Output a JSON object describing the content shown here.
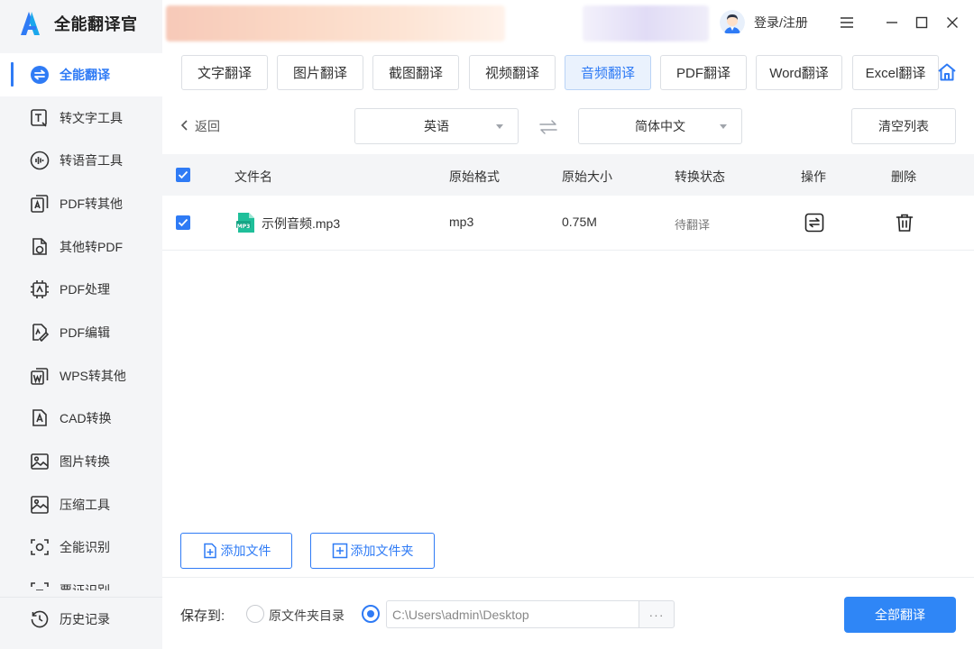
{
  "app": {
    "title": "全能翻译官"
  },
  "header": {
    "login_label": "登录/注册"
  },
  "sidebar": {
    "items": [
      {
        "label": "全能翻译",
        "icon": "translate-icon",
        "active": true
      },
      {
        "label": "转文字工具",
        "icon": "text-convert-icon"
      },
      {
        "label": "转语音工具",
        "icon": "voice-icon"
      },
      {
        "label": "PDF转其他",
        "icon": "pdf-export-icon"
      },
      {
        "label": "其他转PDF",
        "icon": "pdf-import-icon"
      },
      {
        "label": "PDF处理",
        "icon": "pdf-process-icon"
      },
      {
        "label": "PDF编辑",
        "icon": "pdf-edit-icon"
      },
      {
        "label": "WPS转其他",
        "icon": "wps-icon"
      },
      {
        "label": "CAD转换",
        "icon": "cad-icon"
      },
      {
        "label": "图片转换",
        "icon": "image-convert-icon"
      },
      {
        "label": "压缩工具",
        "icon": "compress-icon"
      },
      {
        "label": "全能识别",
        "icon": "recognize-icon"
      },
      {
        "label": "票证识别",
        "icon": "ticket-icon"
      }
    ],
    "history_label": "历史记录"
  },
  "tabs": [
    "文字翻译",
    "图片翻译",
    "截图翻译",
    "视频翻译",
    "音频翻译",
    "PDF翻译",
    "Word翻译",
    "Excel翻译"
  ],
  "active_tab": "音频翻译",
  "toolbar": {
    "back_label": "返回",
    "source_lang": "英语",
    "target_lang": "简体中文",
    "clear_label": "清空列表"
  },
  "table": {
    "columns": [
      "文件名",
      "原始格式",
      "原始大小",
      "转换状态",
      "操作",
      "删除"
    ],
    "rows": [
      {
        "name": "示例音频.mp3",
        "format": "mp3",
        "size": "0.75M",
        "status": "待翻译",
        "file_icon_text": "MP3"
      }
    ]
  },
  "actions": {
    "add_file": "添加文件",
    "add_folder": "添加文件夹"
  },
  "footer": {
    "save_to_label": "保存到:",
    "option_source": "原文件夹目录",
    "path_value": "C:\\Users\\admin\\Desktop",
    "browse_label": "···",
    "translate_all": "全部翻译"
  },
  "colors": {
    "accent": "#2f7bf5",
    "primary_button": "#2f86f6",
    "active_tab_bg": "#eaf2fd",
    "file_icon": "#1fbf9a"
  }
}
